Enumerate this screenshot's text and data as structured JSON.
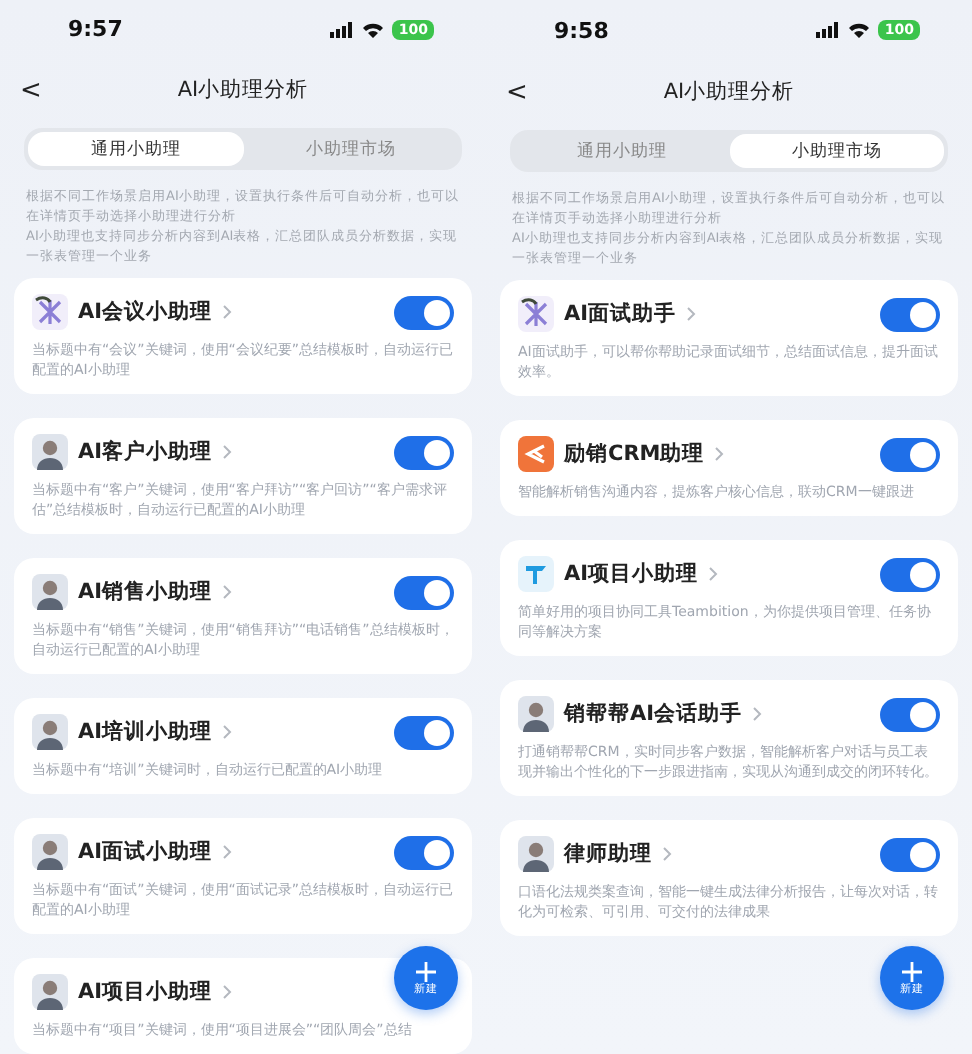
{
  "screens": [
    {
      "status_bar": {
        "time": "9:57",
        "battery": "100"
      },
      "nav": {
        "back": "<",
        "title": "AI小助理分析"
      },
      "tabs": [
        {
          "label": "通用小助理",
          "selected": true
        },
        {
          "label": "小助理市场",
          "selected": false
        }
      ],
      "intro": [
        "根据不同工作场景启用AI小助理，设置执行条件后可自动分析，也可以在详情页手动选择小助理进行分析",
        "AI小助理也支持同步分析内容到AI表格，汇总团队成员分析数据，实现一张表管理一个业务"
      ],
      "cards": [
        {
          "title": "AI会议小助理",
          "kind": "app",
          "on": true,
          "description": "当标题中有“会议”关键词，使用“会议纪要”总结模板时，自动运行已配置的AI小助理"
        },
        {
          "title": "AI客户小助理",
          "kind": "person",
          "on": true,
          "description": "当标题中有“客户”关键词，使用“客户拜访”“客户回访”“客户需求评估”总结模板时，自动运行已配置的AI小助理"
        },
        {
          "title": "AI销售小助理",
          "kind": "person",
          "on": true,
          "description": "当标题中有“销售”关键词，使用“销售拜访”“电话销售”总结模板时，自动运行已配置的AI小助理"
        },
        {
          "title": "AI培训小助理",
          "kind": "person",
          "on": true,
          "description": "当标题中有“培训”关键词时，自动运行已配置的AI小助理"
        },
        {
          "title": "AI面试小助理",
          "kind": "person",
          "on": true,
          "description": "当标题中有“面试”关键词，使用“面试记录”总结模板时，自动运行已配置的AI小助理"
        },
        {
          "title": "AI项目小助理",
          "kind": "person",
          "description": "当标题中有“项目”关键词，使用“项目进展会”“团队周会”总结"
        }
      ],
      "fab": {
        "label": "新建"
      }
    },
    {
      "status_bar": {
        "time": "9:58",
        "battery": "100"
      },
      "nav": {
        "back": "<",
        "title": "AI小助理分析"
      },
      "tabs": [
        {
          "label": "通用小助理",
          "selected": false
        },
        {
          "label": "小助理市场",
          "selected": true
        }
      ],
      "intro": [
        "根据不同工作场景启用AI小助理，设置执行条件后可自动分析，也可以在详情页手动选择小助理进行分析",
        "AI小助理也支持同步分析内容到AI表格，汇总团队成员分析数据，实现一张表管理一个业务"
      ],
      "cards": [
        {
          "title": "AI面试助手",
          "kind": "app",
          "on": true,
          "description": "AI面试助手，可以帮你帮助记录面试细节，总结面试信息，提升面试效率。"
        },
        {
          "title": "励销CRM助理",
          "kind": "crm",
          "on": true,
          "description": "智能解析销售沟通内容，提炼客户核心信息，联动CRM一键跟进"
        },
        {
          "title": "AI项目小助理",
          "kind": "project",
          "on": true,
          "description": "简单好用的项目协同工具Teambition，为你提供项目管理、任务协同等解决方案"
        },
        {
          "title": "销帮帮AI会话助手",
          "kind": "person",
          "on": true,
          "description": "打通销帮帮CRM，实时同步客户数据，智能解析客户对话与员工表现并输出个性化的下一步跟进指南，实现从沟通到成交的闭环转化。"
        },
        {
          "title": "律师助理",
          "kind": "person",
          "on": true,
          "description": "口语化法规类案查询，智能一键生成法律分析报告，让每次对话，转化为可检索、可引用、可交付的法律成果"
        }
      ],
      "fab": {
        "label": "新建"
      }
    }
  ]
}
